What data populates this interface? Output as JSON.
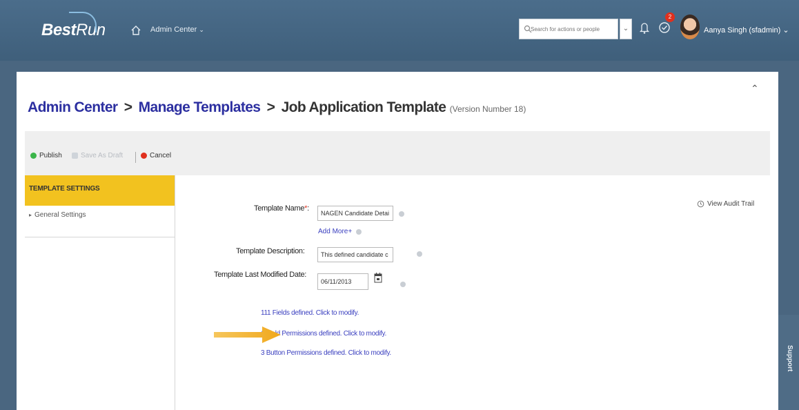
{
  "shell": {
    "logo_best": "Best",
    "logo_run": "Run",
    "nav_label": "Admin Center",
    "search_placeholder": "Search for actions or people",
    "todo_badge": "2",
    "user_name": "Aanya Singh (sfadmin)"
  },
  "breadcrumb": {
    "item1": "Admin Center",
    "sep": ">",
    "item2": "Manage Templates",
    "current": "Job Application Template",
    "version": "(Version Number 18)"
  },
  "toolbar": {
    "publish": "Publish",
    "save_draft": "Save As Draft",
    "cancel": "Cancel"
  },
  "sidebar": {
    "header": "TEMPLATE SETTINGS",
    "items": [
      {
        "label": "General Settings"
      }
    ]
  },
  "form": {
    "audit_label": "View Audit Trail",
    "template_name_label": "Template Name",
    "template_name_value": "NAGEN Candidate Detai",
    "add_more": "Add More+",
    "description_label": "Template Description:",
    "description_value": "This defined candidate c",
    "modified_label": "Template Last Modified Date:",
    "modified_value": "06/11/2013",
    "fields_link": "111 Fields defined. Click to modify.",
    "field_perm_link": "1 Field Permissions defined. Click to modify.",
    "button_perm_link": "3 Button Permissions defined. Click to modify."
  },
  "support": {
    "label": "Support"
  },
  "colors": {
    "shell": "#4b6d8b",
    "accent_yellow": "#f2c21f",
    "link": "#2c2fa0",
    "arrow": "#f0a81c"
  },
  "icons": [
    "home-icon",
    "search-icon",
    "bell-icon",
    "todo-icon",
    "help-icon",
    "calendar-icon",
    "history-icon",
    "publish-icon",
    "save-icon",
    "cancel-icon",
    "collapse-icon"
  ]
}
